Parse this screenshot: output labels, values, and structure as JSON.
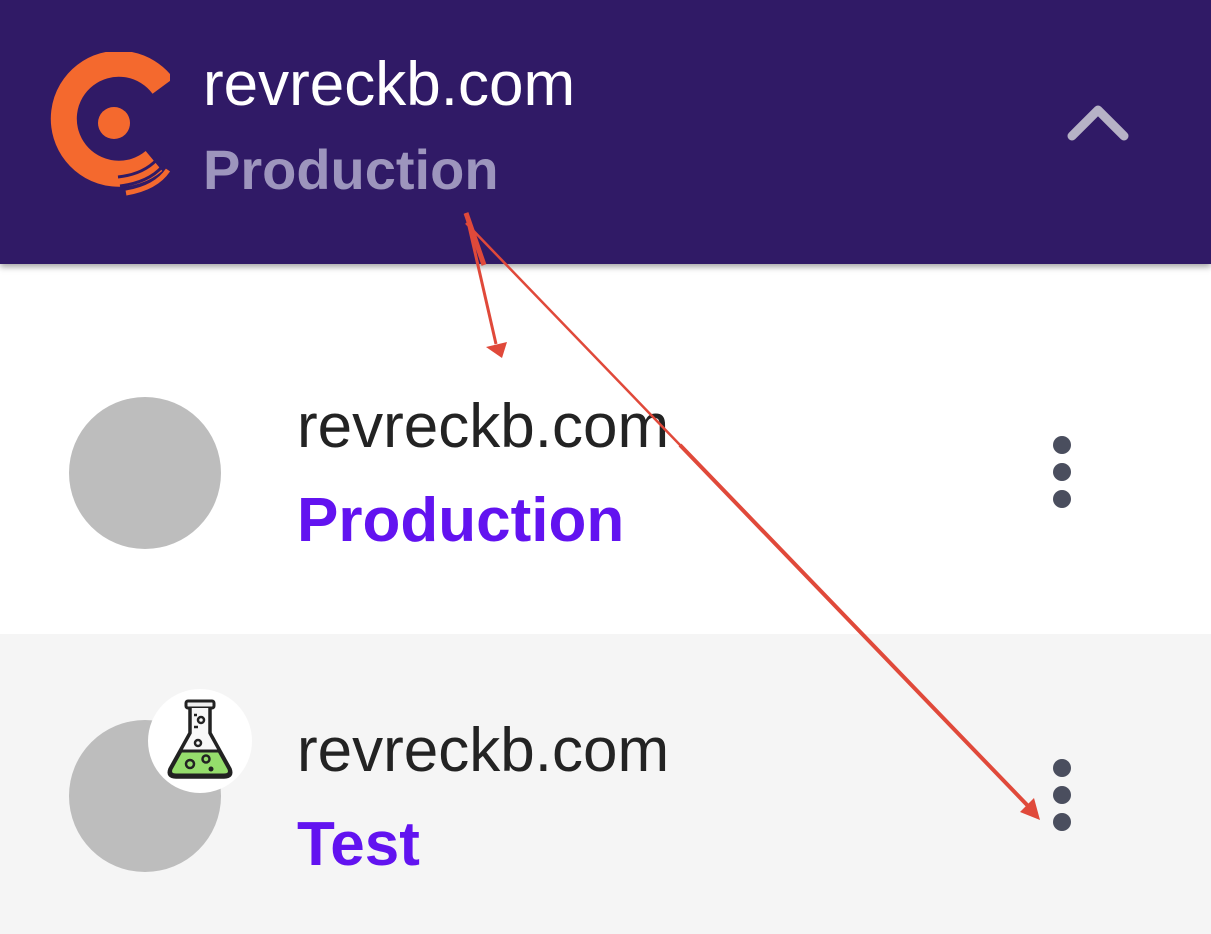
{
  "header": {
    "logo_icon": "circle-logo-icon",
    "title": "revreckb.com",
    "subtitle": "Production",
    "collapse_icon": "chevron-up-icon",
    "bg_color": "#301a66",
    "logo_color": "#f4692e"
  },
  "environments": [
    {
      "title": "revreckb.com",
      "subtitle": "Production",
      "badge_icon": null,
      "menu_icon": "more-vertical-icon"
    },
    {
      "title": "revreckb.com",
      "subtitle": "Test",
      "badge_icon": "flask-icon",
      "menu_icon": "more-vertical-icon"
    }
  ],
  "colors": {
    "accent": "#6213f0",
    "annotation_arrow": "#e0493a"
  }
}
